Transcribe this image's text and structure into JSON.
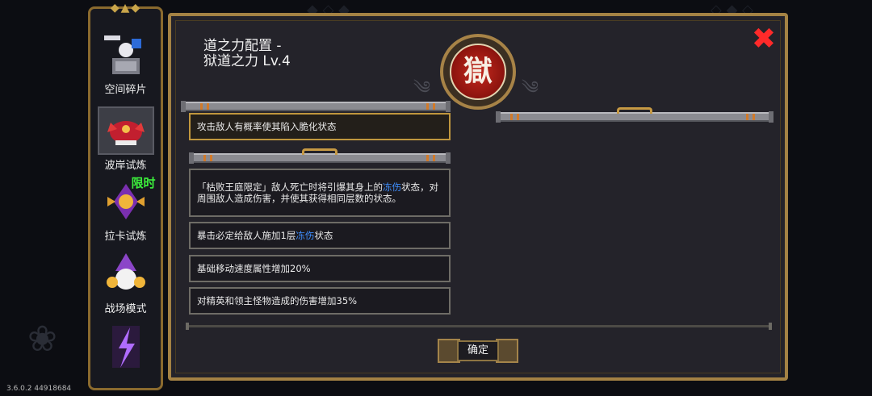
{
  "sidebar": {
    "items": [
      {
        "label": "空间碎片",
        "icon": "space-fragment-icon"
      },
      {
        "label": "波岸试炼",
        "icon": "wave-trial-icon",
        "active": true
      },
      {
        "label": "拉卡试炼",
        "icon": "laka-trial-icon",
        "badge": "限时"
      },
      {
        "label": "战场模式",
        "icon": "battlefield-icon"
      },
      {
        "label": "",
        "icon": "lightning-icon"
      }
    ]
  },
  "dialog": {
    "title_line1": "道之力配置 -",
    "title_line2": "狱道之力 Lv.4",
    "emblem_char": "獄",
    "close_icon": "close-icon",
    "effect_main": "攻击敌人有概率使其陷入脆化状态",
    "effects": [
      {
        "parts": [
          "「枯败王庭限定」敌人死亡时将引爆其身上的",
          "冻伤",
          "状态，对周围敌人造成伤害，并使其获得相同层数的状态。"
        ]
      },
      {
        "parts": [
          "暴击必定给敌人施加1层",
          "冻伤",
          "状态"
        ]
      },
      {
        "parts": [
          "基础移动速度属性增加20%"
        ]
      },
      {
        "parts": [
          "对精英和领主怪物造成的伤害增加35%"
        ]
      }
    ],
    "confirm_label": "确定"
  },
  "footer": {
    "version": "3.6.0.2 44918684"
  },
  "colors": {
    "frame_gold": "#a48244",
    "close_red": "#ff2a2a",
    "highlight_blue": "#3f8fff",
    "limited_green": "#3cf03c",
    "emblem_red": "#c52a1e"
  }
}
